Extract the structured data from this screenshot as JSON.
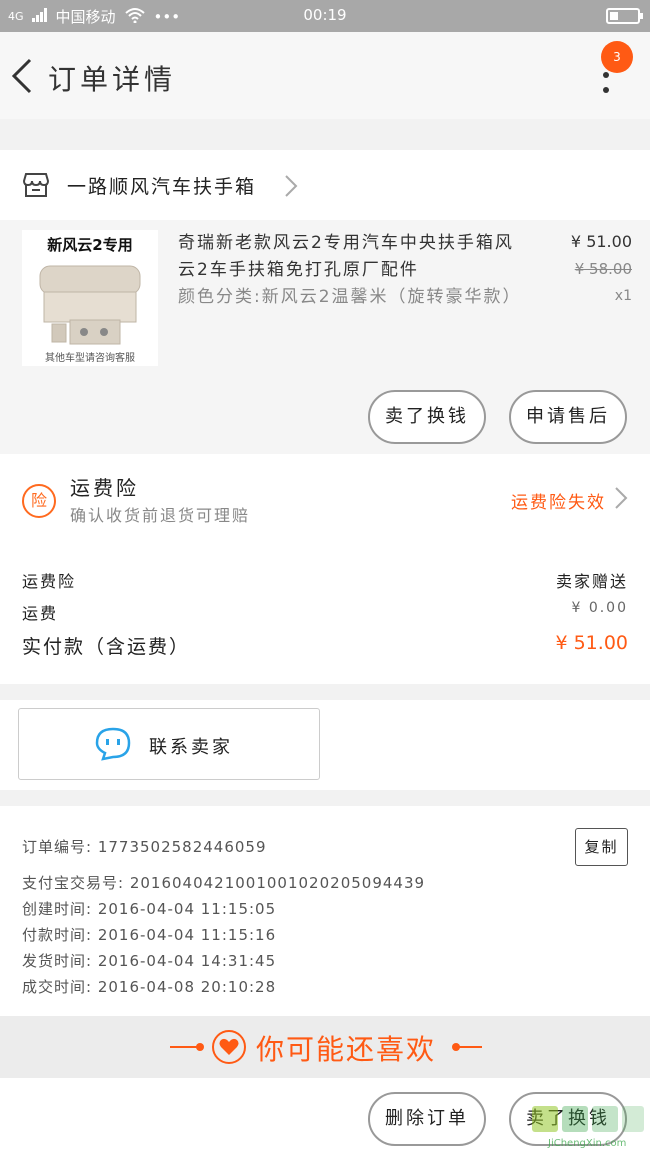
{
  "status_bar": {
    "carrier": "中国移动",
    "signal": "4G",
    "dots": "•••",
    "time": "00:19"
  },
  "header": {
    "title": "订单详情",
    "badge": "3"
  },
  "shop": {
    "name": "一路顺风汽车扶手箱"
  },
  "item": {
    "image_caption": "新风云2专用",
    "image_footer": "其他车型请咨询客服",
    "name": "奇瑞新老款风云2专用汽车中央扶手箱风云2车手扶箱免打孔原厂配件",
    "spec": "颜色分类:新风云2温馨米（旋转豪华款）",
    "price": "¥ 51.00",
    "original_price": "¥ 58.00",
    "quantity": "x1",
    "buttons": {
      "sell": "卖了换钱",
      "after_sales": "申请售后"
    }
  },
  "insurance": {
    "icon_char": "险",
    "title": "运费险",
    "subtitle": "确认收货前退货可理赔",
    "status": "运费险失效"
  },
  "fees": {
    "rows": [
      {
        "label": "运费险",
        "value": "卖家赠送"
      },
      {
        "label": "运费",
        "value": "¥ 0.00"
      },
      {
        "label": "实付款（含运费）",
        "value": "¥ 51.00"
      }
    ]
  },
  "contact": {
    "label": "联系卖家"
  },
  "order_info": {
    "order_no": "订单编号: 1773502582446059",
    "copy": "复制",
    "alipay_no": "支付宝交易号: 2016040421001001020205094439",
    "created": "创建时间: 2016-04-04 11:15:05",
    "paid": "付款时间: 2016-04-04 11:15:16",
    "shipped": "发货时间: 2016-04-04 14:31:45",
    "completed": "成交时间: 2016-04-08 20:10:28"
  },
  "recommend": {
    "title": "你可能还喜欢"
  },
  "bottom": {
    "delete": "删除订单",
    "sell": "卖了换钱"
  },
  "watermark": {
    "text": "JiChengXin.com"
  },
  "colors": {
    "accent": "#ff5a14",
    "contact_icon": "#29a3e8"
  }
}
